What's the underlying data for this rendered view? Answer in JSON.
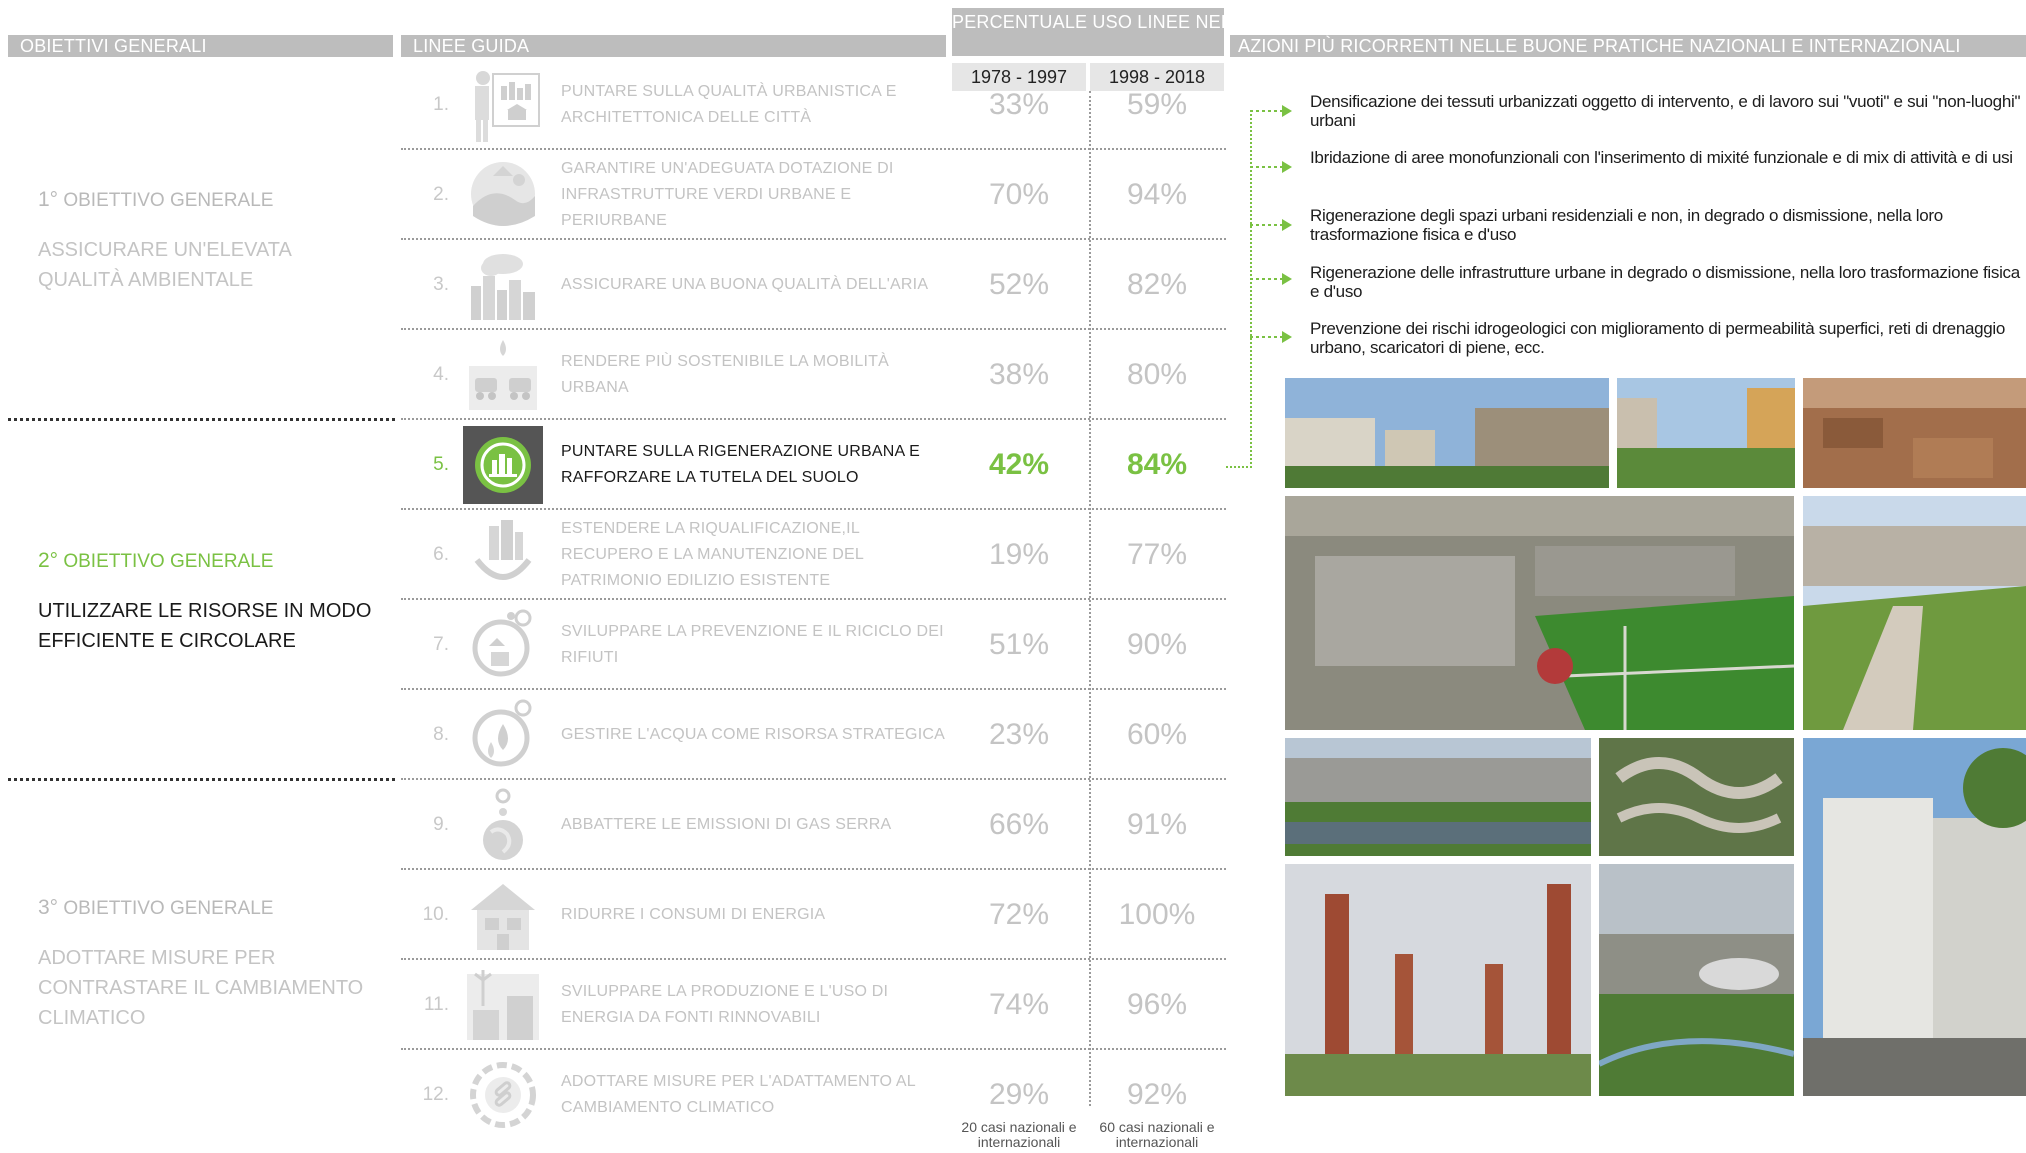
{
  "headers": {
    "objectives": "OBIETTIVI GENERALI",
    "guidelines": "LINEE GUIDA",
    "percentage": "PERCENTUALE USO LINEE NELLE PRATICHE DEI CASI",
    "actions": "AZIONI PIÙ RICORRENTI NELLE BUONE PRATICHE NAZIONALI E INTERNAZIONALI"
  },
  "periods": [
    "1978 - 1997",
    "1998 - 2018"
  ],
  "objectives": [
    {
      "ordinal": "1°",
      "title": "OBIETTIVO GENERALE",
      "description": "ASSICURARE UN'ELEVATA QUALITÀ AMBIENTALE",
      "active": false
    },
    {
      "ordinal": "2°",
      "title": "OBIETTIVO GENERALE",
      "description": "UTILIZZARE LE RISORSE IN MODO EFFICIENTE E CIRCOLARE",
      "active": true
    },
    {
      "ordinal": "3°",
      "title": "OBIETTIVO GENERALE",
      "description": "ADOTTARE MISURE PER CONTRASTARE IL CAMBIAMENTO CLIMATICO",
      "active": false
    }
  ],
  "guidelines": [
    {
      "num": "1.",
      "label": "PUNTARE SULLA QUALITÀ URBANISTICA E ARCHITETTONICA DELLE CITTÀ",
      "v1": "33%",
      "v2": "59%",
      "icon": "city-planner-icon",
      "active": false
    },
    {
      "num": "2.",
      "label": "GARANTIRE UN'ADEGUATA DOTAZIONE DI INFRASTRUTTURE VERDI URBANE E PERIURBANE",
      "v1": "70%",
      "v2": "94%",
      "icon": "green-infrastructure-icon",
      "active": false
    },
    {
      "num": "3.",
      "label": "ASSICURARE UNA BUONA QUALITÀ DELL'ARIA",
      "v1": "52%",
      "v2": "82%",
      "icon": "air-quality-icon",
      "active": false
    },
    {
      "num": "4.",
      "label": "RENDERE PIÙ SOSTENIBILE LA MOBILITÀ URBANA",
      "v1": "38%",
      "v2": "80%",
      "icon": "mobility-icon",
      "active": false
    },
    {
      "num": "5.",
      "label": "PUNTARE SULLA RIGENERAZIONE URBANA E RAFFORZARE LA TUTELA DEL SUOLO",
      "v1": "42%",
      "v2": "84%",
      "icon": "urban-regeneration-icon",
      "active": true
    },
    {
      "num": "6.",
      "label": "ESTENDERE LA RIQUALIFICAZIONE,IL RECUPERO E LA MANUTENZIONE DEL PATRIMONIO EDILIZIO ESISTENTE",
      "v1": "19%",
      "v2": "77%",
      "icon": "building-renovation-icon",
      "active": false
    },
    {
      "num": "7.",
      "label": "SVILUPPARE LA PREVENZIONE E IL RICICLO DEI RIFIUTI",
      "v1": "51%",
      "v2": "90%",
      "icon": "recycling-icon",
      "active": false
    },
    {
      "num": "8.",
      "label": "GESTIRE L'ACQUA COME RISORSA STRATEGICA",
      "v1": "23%",
      "v2": "60%",
      "icon": "water-icon",
      "active": false
    },
    {
      "num": "9.",
      "label": "ABBATTERE LE EMISSIONI DI GAS SERRA",
      "v1": "66%",
      "v2": "91%",
      "icon": "globe-emissions-icon",
      "active": false
    },
    {
      "num": "10.",
      "label": "RIDURRE I CONSUMI DI ENERGIA",
      "v1": "72%",
      "v2": "100%",
      "icon": "energy-house-icon",
      "active": false
    },
    {
      "num": "11.",
      "label": "SVILUPPARE LA PRODUZIONE E L'USO DI ENERGIA DA FONTI RINNOVABILI",
      "v1": "74%",
      "v2": "96%",
      "icon": "renewable-energy-icon",
      "active": false
    },
    {
      "num": "12.",
      "label": "ADOTTARE MISURE PER L'ADATTAMENTO AL CAMBIAMENTO CLIMATICO",
      "v1": "29%",
      "v2": "92%",
      "icon": "climate-adaptation-icon",
      "active": false
    }
  ],
  "footnotes": [
    "20 casi nazionali e internazionali",
    "60 casi nazionali e internazionali"
  ],
  "actions": [
    "Densificazione dei tessuti urbanizzati oggetto di intervento, e di lavoro sui \"vuoti\" e sui \"non-luoghi\" urbani",
    "Ibridazione di aree monofunzionali con l'inserimento di mixité funzionale e di mix di attività e di usi",
    "Rigenerazione degli spazi urbani residenziali e non, in degrado o dismissione, nella loro trasformazione fisica e d'uso",
    "Rigenerazione delle infrastrutture urbane in degrado o dismissione, nella loro trasformazione fisica e d'uso",
    "Prevenzione dei rischi idrogeologici con miglioramento di permeabilità superfici, reti di drenaggio urbano, scaricatori di piene, ecc."
  ],
  "colors": {
    "accent": "#7ac143",
    "header": "#bdbdbd",
    "muted": "#c4c4c4"
  }
}
